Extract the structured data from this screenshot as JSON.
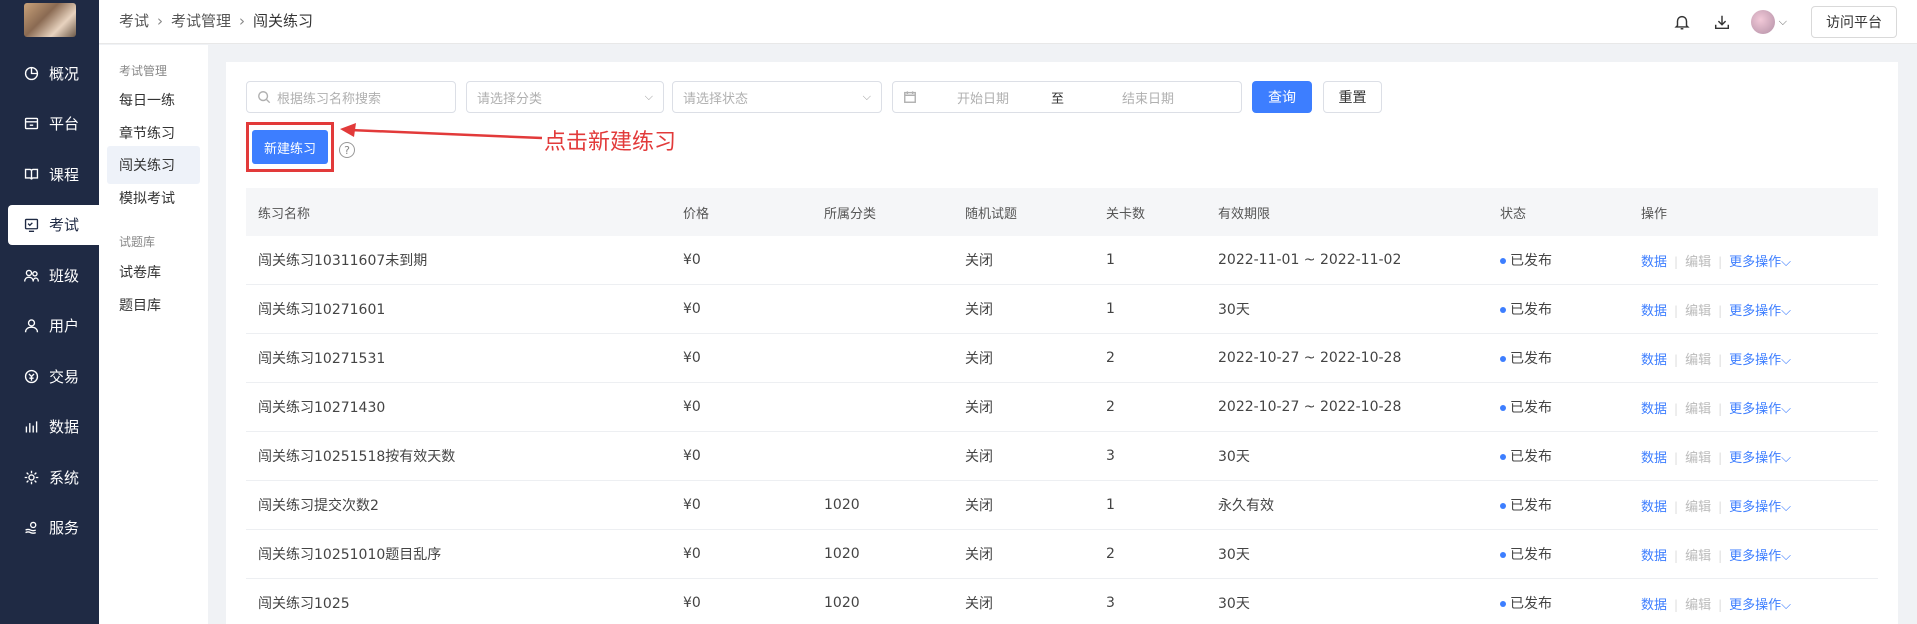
{
  "sidebar": {
    "items": [
      {
        "label": "概况",
        "icon": "pie-chart-icon"
      },
      {
        "label": "平台",
        "icon": "platform-icon"
      },
      {
        "label": "课程",
        "icon": "book-icon"
      },
      {
        "label": "考试",
        "icon": "exam-icon"
      },
      {
        "label": "班级",
        "icon": "class-icon"
      },
      {
        "label": "用户",
        "icon": "user-icon"
      },
      {
        "label": "交易",
        "icon": "trade-icon"
      },
      {
        "label": "数据",
        "icon": "bar-chart-icon"
      },
      {
        "label": "系统",
        "icon": "gear-icon"
      },
      {
        "label": "服务",
        "icon": "service-icon"
      }
    ],
    "active_index": 3
  },
  "header": {
    "breadcrumb": [
      "考试",
      "考试管理",
      "闯关练习"
    ],
    "visit_button": "访问平台"
  },
  "subnav": {
    "group1": "考试管理",
    "items1": [
      "每日一练",
      "章节练习",
      "闯关练习",
      "模拟考试"
    ],
    "group2": "试题库",
    "items2": [
      "试卷库",
      "题目库"
    ]
  },
  "filters": {
    "search_placeholder": "根据练习名称搜索",
    "category_placeholder": "请选择分类",
    "status_placeholder": "请选择状态",
    "start_date": "开始日期",
    "date_sep": "至",
    "end_date": "结束日期",
    "query_button": "查询",
    "reset_button": "重置"
  },
  "new_button": "新建练习",
  "help_glyph": "?",
  "annotation": "点击新建练习",
  "table": {
    "headers": [
      "练习名称",
      "价格",
      "所属分类",
      "随机试题",
      "关卡数",
      "有效期限",
      "状态",
      "操作"
    ],
    "rows": [
      {
        "name": "闯关练习10311607未到期",
        "price": "¥0",
        "category": "",
        "random": "关闭",
        "levels": "1",
        "validity": "2022-11-01 ~ 2022-11-02",
        "status": "已发布"
      },
      {
        "name": "闯关练习10271601",
        "price": "¥0",
        "category": "",
        "random": "关闭",
        "levels": "1",
        "validity": "30天",
        "status": "已发布"
      },
      {
        "name": "闯关练习10271531",
        "price": "¥0",
        "category": "",
        "random": "关闭",
        "levels": "2",
        "validity": "2022-10-27 ~ 2022-10-28",
        "status": "已发布"
      },
      {
        "name": "闯关练习10271430",
        "price": "¥0",
        "category": "",
        "random": "关闭",
        "levels": "2",
        "validity": "2022-10-27 ~ 2022-10-28",
        "status": "已发布"
      },
      {
        "name": "闯关练习10251518按有效天数",
        "price": "¥0",
        "category": "",
        "random": "关闭",
        "levels": "3",
        "validity": "30天",
        "status": "已发布"
      },
      {
        "name": "闯关练习提交次数2",
        "price": "¥0",
        "category": "1020",
        "random": "关闭",
        "levels": "1",
        "validity": "永久有效",
        "status": "已发布"
      },
      {
        "name": "闯关练习10251010题目乱序",
        "price": "¥0",
        "category": "1020",
        "random": "关闭",
        "levels": "2",
        "validity": "30天",
        "status": "已发布"
      },
      {
        "name": "闯关练习1025",
        "price": "¥0",
        "category": "1020",
        "random": "关闭",
        "levels": "3",
        "validity": "30天",
        "status": "已发布"
      }
    ],
    "ops": {
      "data": "数据",
      "edit": "编辑",
      "more": "更多操作"
    }
  },
  "colors": {
    "sidebar_bg": "#1f2a44",
    "primary": "#3d7eff",
    "annotation": "#e23a3a"
  }
}
